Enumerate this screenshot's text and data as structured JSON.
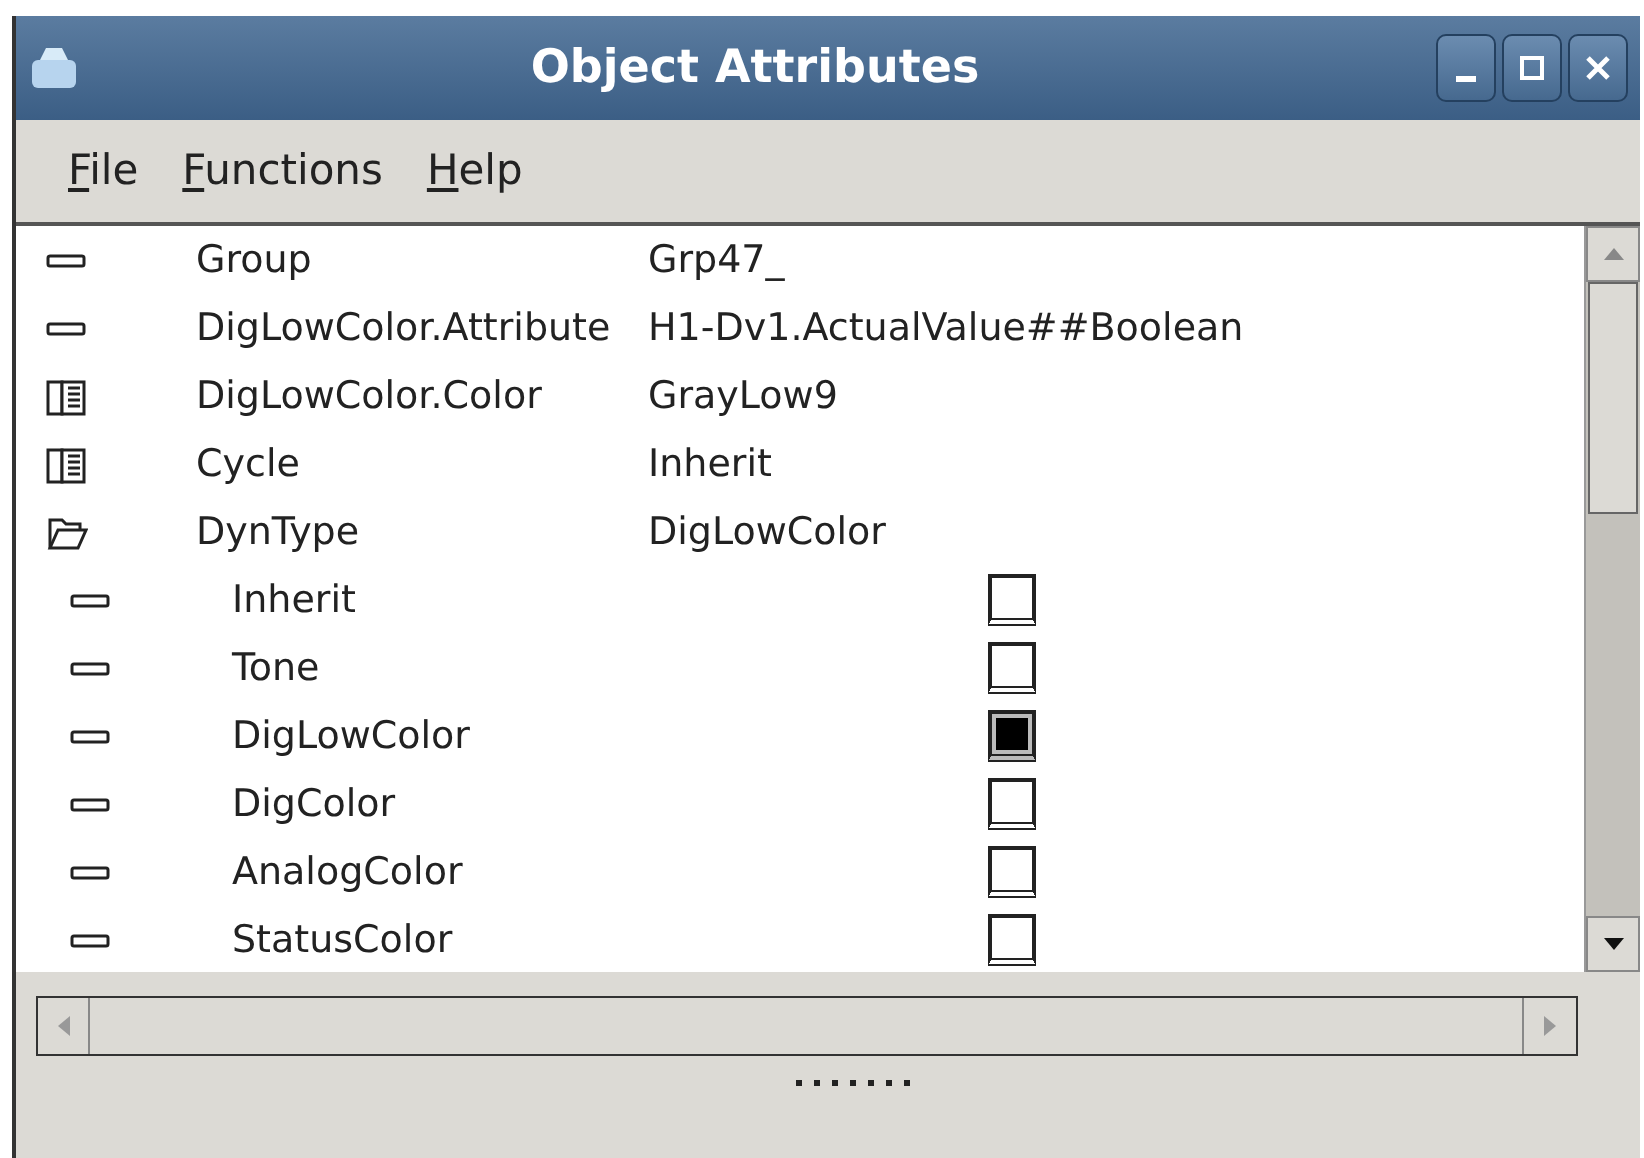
{
  "window": {
    "title": "Object Attributes"
  },
  "menu": [
    {
      "label": "File"
    },
    {
      "label": "Functions"
    },
    {
      "label": "Help"
    }
  ],
  "attributes": [
    {
      "kind": "leaf",
      "name": "Group",
      "value": "Grp47_"
    },
    {
      "kind": "leaf",
      "name": "DigLowColor.Attribute",
      "value": "H1-Dv1.ActualValue##Boolean"
    },
    {
      "kind": "closed",
      "name": "DigLowColor.Color",
      "value": "GrayLow9"
    },
    {
      "kind": "closed",
      "name": "Cycle",
      "value": "Inherit"
    },
    {
      "kind": "open",
      "name": "DynType",
      "value": "DigLowColor",
      "children": [
        {
          "kind": "leaf",
          "name": "Inherit",
          "checked": false
        },
        {
          "kind": "leaf",
          "name": "Tone",
          "checked": false
        },
        {
          "kind": "leaf",
          "name": "DigLowColor",
          "checked": true
        },
        {
          "kind": "leaf",
          "name": "DigColor",
          "checked": false
        },
        {
          "kind": "leaf",
          "name": "AnalogColor",
          "checked": false
        },
        {
          "kind": "leaf",
          "name": "StatusColor",
          "checked": false
        }
      ]
    }
  ]
}
